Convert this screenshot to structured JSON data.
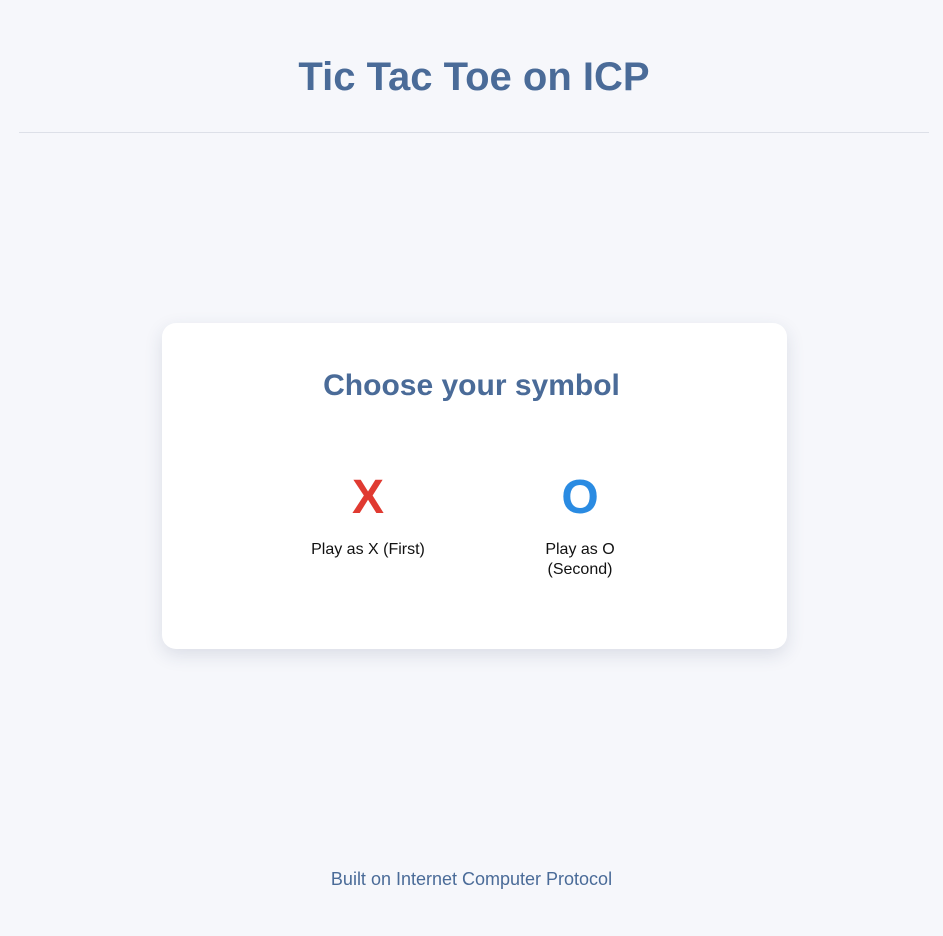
{
  "header": {
    "title": "Tic Tac Toe on ICP"
  },
  "chooser": {
    "title": "Choose your symbol",
    "options": [
      {
        "symbol": "X",
        "label": "Play as X (First)",
        "color": "#e03a31"
      },
      {
        "symbol": "O",
        "label": "Play as O (Second)",
        "color": "#2a8be2"
      }
    ]
  },
  "footer": {
    "text": "Built on Internet Computer Protocol"
  },
  "colors": {
    "background": "#f6f7fb",
    "accent": "#4a6b98",
    "card": "#ffffff"
  }
}
